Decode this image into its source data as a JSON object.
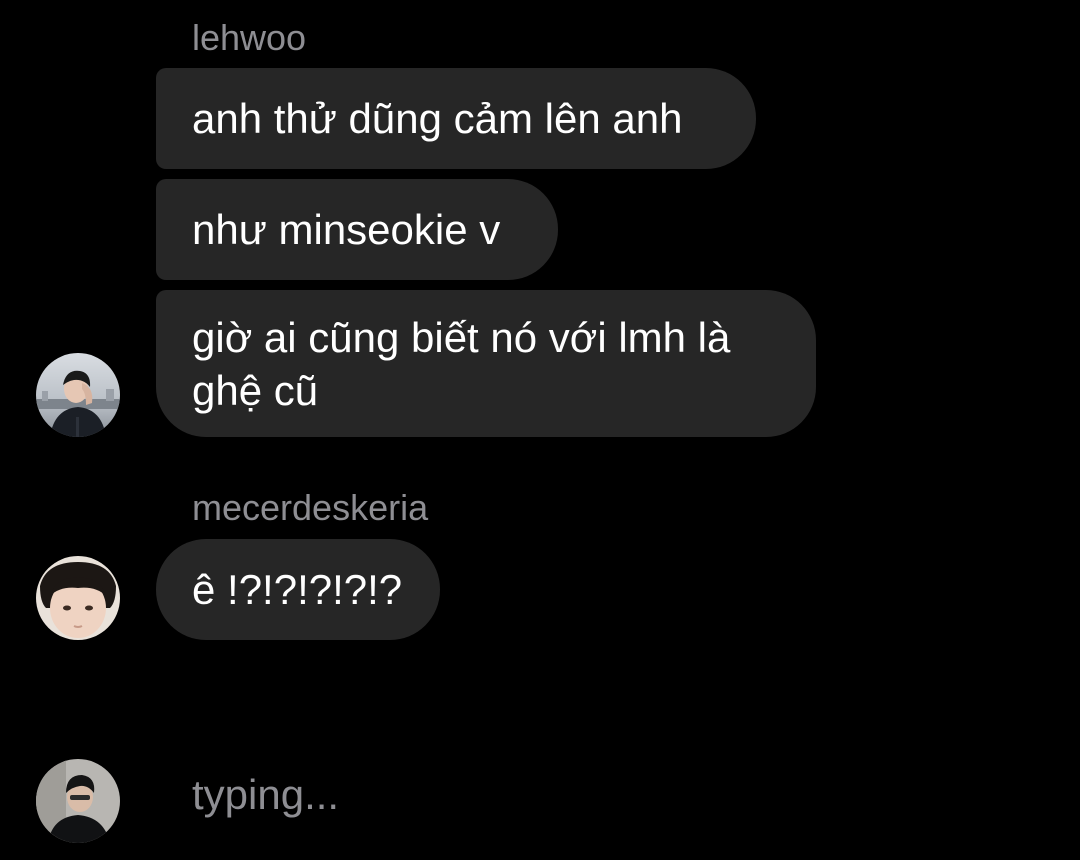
{
  "groups": [
    {
      "sender": "lehwoo",
      "avatar_icon": "user-avatar-icon",
      "messages": [
        "anh thử dũng cảm lên anh",
        "như minseokie v",
        "giờ ai cũng biết nó với lmh là ghệ cũ"
      ]
    },
    {
      "sender": "mecerdeskeria",
      "avatar_icon": "user-avatar-icon",
      "messages": [
        "ê !?!?!?!?!?"
      ]
    }
  ],
  "typing": {
    "text": "typing...",
    "avatar_icon": "user-avatar-icon"
  },
  "colors": {
    "background": "#000000",
    "bubble": "#262626",
    "bubble_text": "#ffffff",
    "secondary_text": "#8e8e93"
  }
}
